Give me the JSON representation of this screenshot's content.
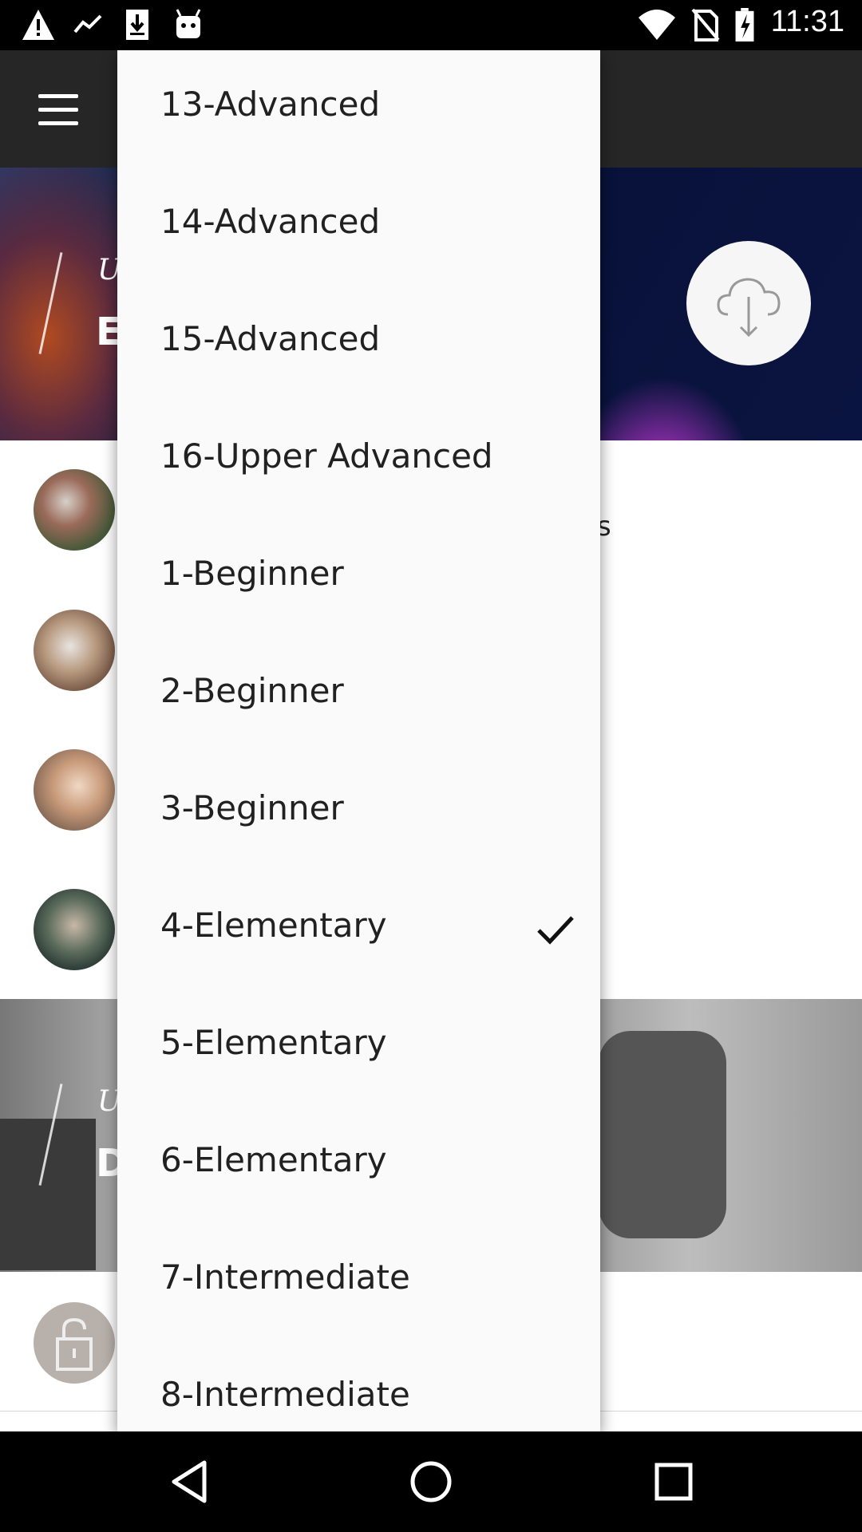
{
  "status_bar": {
    "time": "11:31",
    "left_icons": [
      "warning-icon",
      "trend-icon",
      "download-icon",
      "android-icon"
    ],
    "right_icons": [
      "wifi-icon",
      "no-sim-icon",
      "battery-charging-icon"
    ]
  },
  "app_bar": {
    "menu_icon": "hamburger-menu-icon"
  },
  "hero_1": {
    "partial_subtitle": "U",
    "partial_title": "E",
    "action_icon": "cloud-download-icon"
  },
  "list_rows": [
    {
      "partial_text": "s",
      "avatar": "group-photo"
    },
    {
      "partial_text": "",
      "avatar": "computer-photo"
    },
    {
      "partial_text": "",
      "avatar": "phone-call-photo"
    },
    {
      "partial_text": "",
      "avatar": "friends-photo"
    }
  ],
  "hero_2": {
    "partial_subtitle": "U",
    "partial_title": "D"
  },
  "locked_row": {
    "avatar": "lock-icon"
  },
  "dropdown": {
    "selected": "4-Elementary",
    "items": [
      {
        "label": "13-Advanced",
        "selected": false
      },
      {
        "label": "14-Advanced",
        "selected": false
      },
      {
        "label": "15-Advanced",
        "selected": false
      },
      {
        "label": "16-Upper Advanced",
        "selected": false
      },
      {
        "label": "1-Beginner",
        "selected": false
      },
      {
        "label": "2-Beginner",
        "selected": false
      },
      {
        "label": "3-Beginner",
        "selected": false
      },
      {
        "label": "4-Elementary",
        "selected": true
      },
      {
        "label": "5-Elementary",
        "selected": false
      },
      {
        "label": "6-Elementary",
        "selected": false
      },
      {
        "label": "7-Intermediate",
        "selected": false
      },
      {
        "label": "8-Intermediate",
        "selected": false
      }
    ]
  },
  "nav_bar": {
    "buttons": [
      "back-icon",
      "home-icon",
      "recents-icon"
    ]
  },
  "colors": {
    "status_bar": "#000000",
    "app_bar": "#262626",
    "dropdown_bg": "#fafafa",
    "text": "#212121"
  }
}
